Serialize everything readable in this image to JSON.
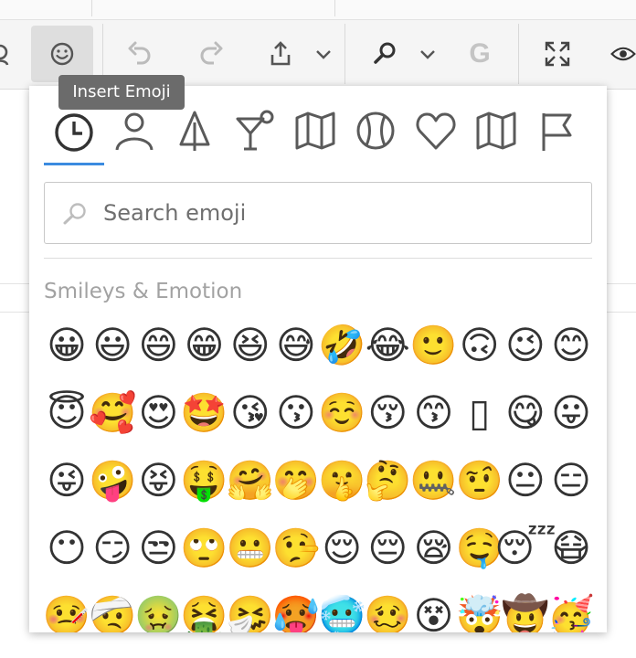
{
  "toolbar": {
    "emoji_tooltip": "Insert Emoji",
    "g_label": "G",
    "buttons": [
      "user-icon",
      "emoji-icon",
      "undo-icon",
      "redo-icon",
      "share-icon",
      "chevron-down-icon",
      "search-icon",
      "chevron-down-icon",
      "grammar-g",
      "expand-icon",
      "eye-icon"
    ]
  },
  "emoji_picker": {
    "categories": [
      "recent",
      "people",
      "nature",
      "food-drink",
      "travel",
      "activity",
      "symbols",
      "objects",
      "flags"
    ],
    "active_category": "recent",
    "accent_color": "#3b8be0",
    "search": {
      "placeholder": "Search emoji",
      "value": ""
    },
    "section_title": "Smileys & Emotion",
    "emojis": [
      "😀",
      "😃",
      "😄",
      "😁",
      "😆",
      "😅",
      "🤣",
      "😂",
      "🙂",
      "🙃",
      "😉",
      "😊",
      "😇",
      "🥰",
      "😍",
      "🤩",
      "😘",
      "😗",
      "☺️",
      "😚",
      "😙",
      "▯",
      "😋",
      "😛",
      "😜",
      "🤪",
      "😝",
      "🤑",
      "🤗",
      "🤭",
      "🤫",
      "🤔",
      "🤐",
      "🤨",
      "😐",
      "😑",
      "😶",
      "😏",
      "😒",
      "🙄",
      "😬",
      "🤥",
      "😌",
      "😔",
      "😪",
      "🤤",
      "😴",
      "😷",
      "🤒",
      "🤕",
      "🤢",
      "🤮",
      "🤧",
      "🥵",
      "🥶",
      "🥴",
      "😵",
      "🤯",
      "🤠",
      "🥳"
    ]
  }
}
